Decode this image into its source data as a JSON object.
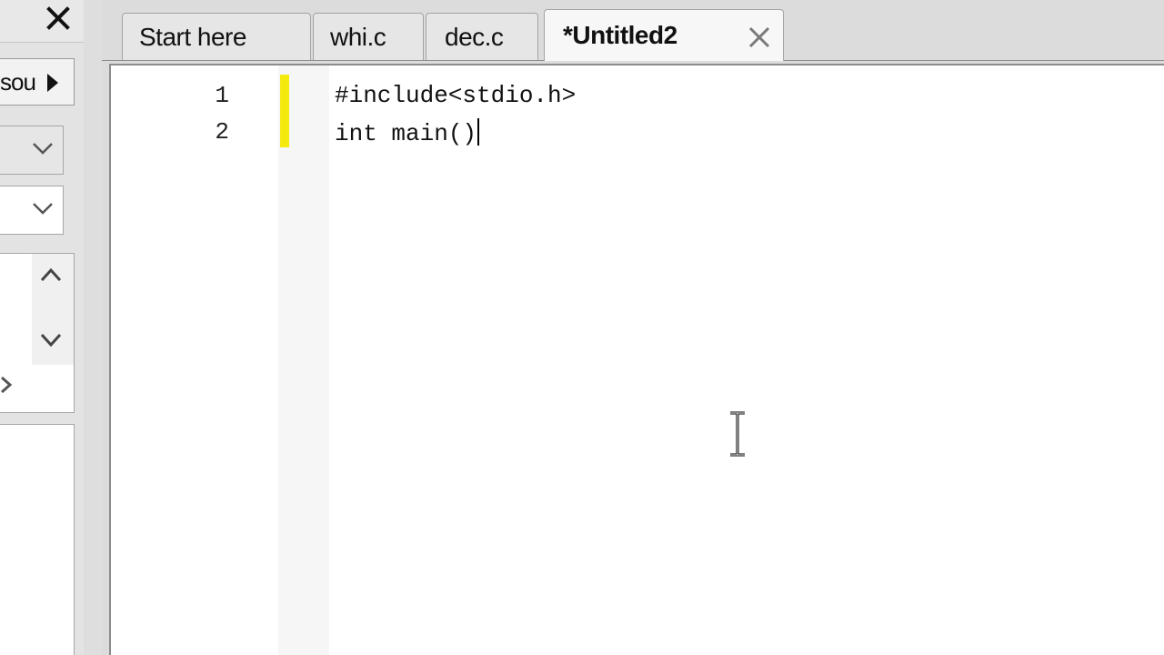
{
  "left_panel": {
    "tab_label": "sou",
    "combo_1_value": "",
    "combo_2_value": ""
  },
  "tabs": [
    {
      "label": "Start here",
      "active": false
    },
    {
      "label": "whi.c",
      "active": false
    },
    {
      "label": "dec.c",
      "active": false
    },
    {
      "label": "*Untitled2",
      "active": true
    }
  ],
  "editor": {
    "lines": [
      {
        "number": "1",
        "text": "#include<stdio.h>"
      },
      {
        "number": "2",
        "text": "int main()"
      }
    ],
    "change_bar_color": "#f4ea0d"
  },
  "icons": {
    "panel_close": "close-icon",
    "tab_close": "close-icon",
    "left_tab_arrow": "triangle-right-icon",
    "combo_chevron": "chevron-down-icon",
    "scroll_up": "chevron-up-icon",
    "scroll_down": "chevron-down-icon",
    "mouse_cursor": "text-cursor-icon"
  }
}
